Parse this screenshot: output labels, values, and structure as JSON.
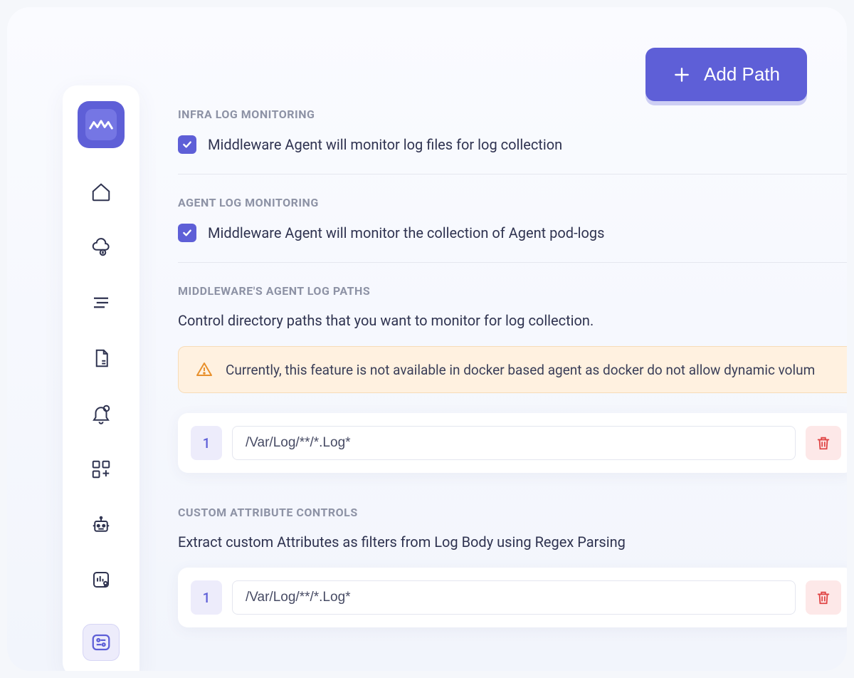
{
  "addPath": {
    "label": "Add Path"
  },
  "sections": {
    "infra": {
      "title": "INFRA LOG MONITORING",
      "checkbox_label": "Middleware Agent will monitor log files for log collection"
    },
    "agent": {
      "title": "AGENT LOG MONITORING",
      "checkbox_label": "Middleware Agent will monitor the collection of Agent pod-logs"
    },
    "paths": {
      "title": "MIDDLEWARE'S AGENT LOG PATHS",
      "desc": "Control directory paths that you want to monitor for log collection.",
      "alert": "Currently, this feature is not available in docker based agent as docker do not allow dynamic volum",
      "items": [
        {
          "num": "1",
          "value": "/Var/Log/**/*.Log*"
        }
      ]
    },
    "custom": {
      "title": "CUSTOM ATTRIBUTE CONTROLS",
      "desc": "Extract custom Attributes as filters from Log Body using Regex Parsing",
      "items": [
        {
          "num": "1",
          "value": "/Var/Log/**/*.Log*"
        }
      ]
    }
  }
}
